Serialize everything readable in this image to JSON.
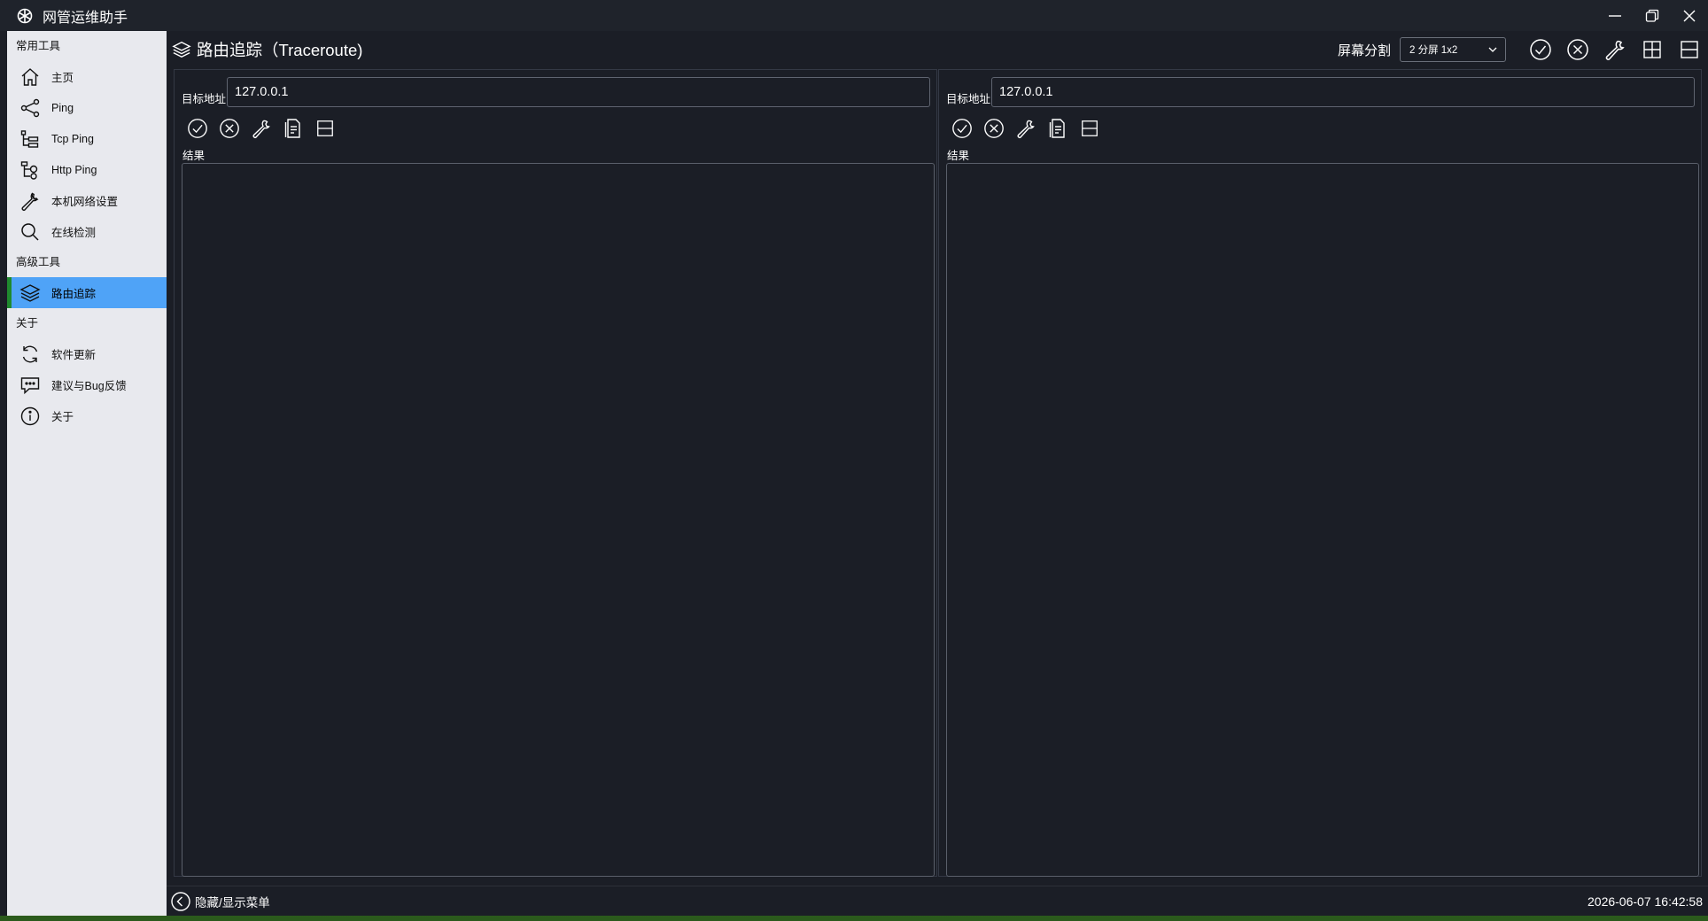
{
  "app": {
    "title": "网管运维助手",
    "icon": "snowflake-icon"
  },
  "window_controls": {
    "minimize_icon": "minimize-icon",
    "restore_icon": "restore-icon",
    "close_icon": "close-icon"
  },
  "sidebar": {
    "groups": [
      {
        "title": "常用工具",
        "items": [
          {
            "label": "主页",
            "icon": "home-icon"
          },
          {
            "label": "Ping",
            "icon": "share-icon"
          },
          {
            "label": "Tcp Ping",
            "icon": "tree-icon"
          },
          {
            "label": "Http Ping",
            "icon": "tree-branch-icon"
          },
          {
            "label": "本机网络设置",
            "icon": "wrench-icon"
          },
          {
            "label": "在线检测",
            "icon": "search-icon"
          }
        ]
      },
      {
        "title": "高级工具",
        "items": [
          {
            "label": "路由追踪",
            "icon": "layers-icon",
            "active": true
          }
        ]
      },
      {
        "title": "关于",
        "items": [
          {
            "label": "软件更新",
            "icon": "refresh-icon"
          },
          {
            "label": "建议与Bug反馈",
            "icon": "comment-icon"
          },
          {
            "label": "关于",
            "icon": "info-icon"
          }
        ]
      }
    ],
    "active_color": "#4fa3f7",
    "active_marker_color": "#1f8a2e"
  },
  "header": {
    "title": "路由追踪（Traceroute)",
    "split_label": "屏幕分割",
    "split_value": "2 分屏 1x2"
  },
  "panes": [
    {
      "target_label": "目标地址",
      "target_value": "127.0.0.1",
      "result_label": "结果"
    },
    {
      "target_label": "目标地址",
      "target_value": "127.0.0.1",
      "result_label": "结果"
    }
  ],
  "footer": {
    "toggle_label": "隐藏/显示菜单",
    "clock": "2026-06-07 16:42:58"
  }
}
